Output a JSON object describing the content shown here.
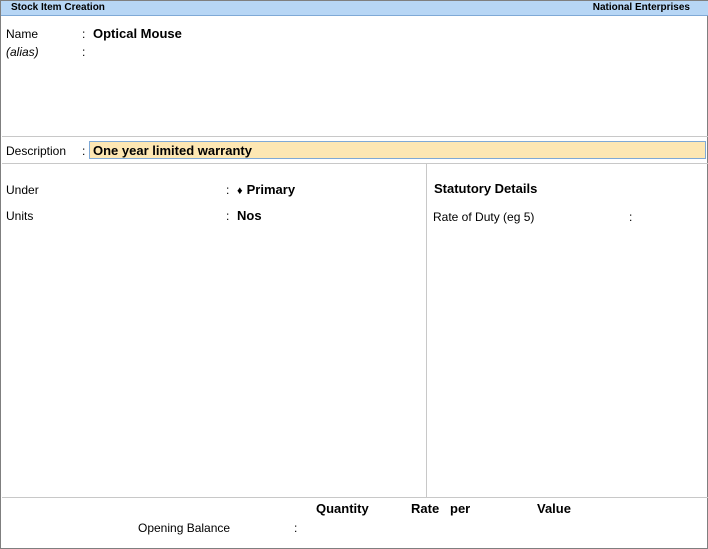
{
  "titlebar": {
    "screen_title": "Stock Item Creation",
    "company": "National Enterprises"
  },
  "name_section": {
    "name_label": "Name",
    "name_value": "Optical Mouse",
    "alias_label": "(alias)",
    "alias_value": ""
  },
  "description": {
    "label": "Description",
    "value": "One year limited warranty"
  },
  "left_panel": {
    "under_label": "Under",
    "under_value": "Primary",
    "units_label": "Units",
    "units_value": "Nos"
  },
  "statutory": {
    "heading": "Statutory Details",
    "rate_label": "Rate of Duty (eg 5)",
    "rate_value": ""
  },
  "opening": {
    "col_quantity": "Quantity",
    "col_rate": "Rate",
    "col_per": "per",
    "col_value": "Value",
    "label": "Opening Balance"
  },
  "separator": ":",
  "icons": {
    "under_marker": "diamond-icon"
  }
}
